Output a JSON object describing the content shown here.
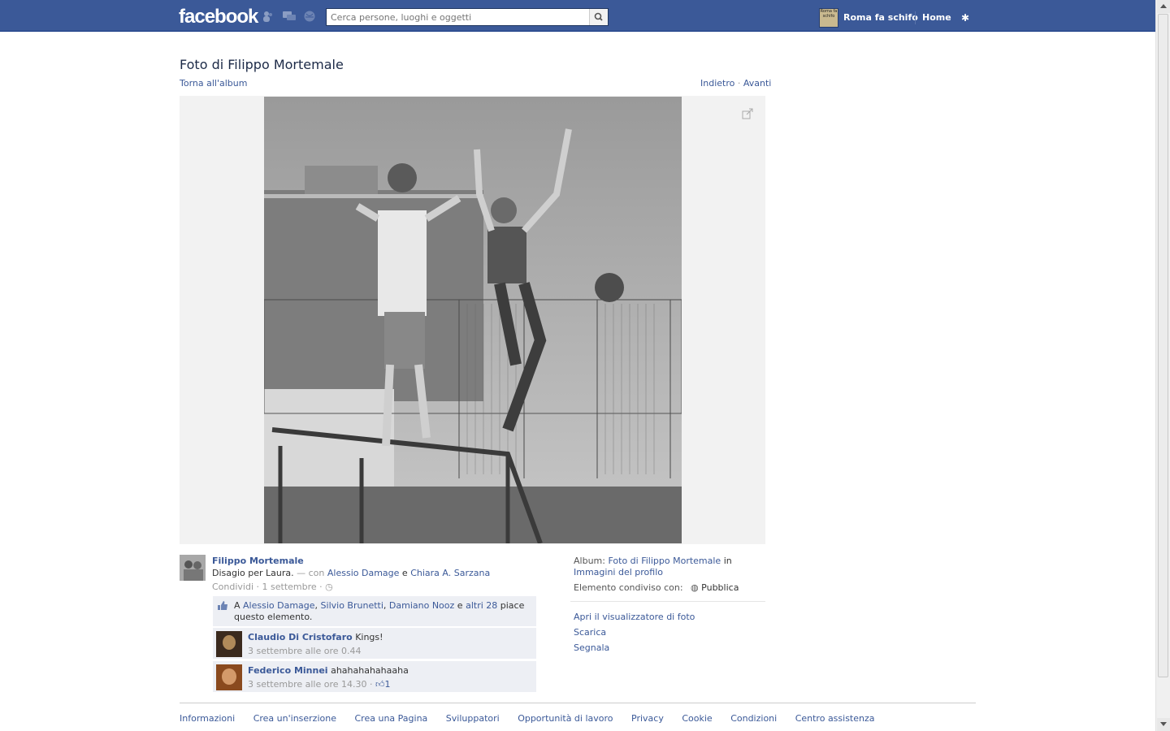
{
  "header": {
    "logo": "facebook",
    "search_placeholder": "Cerca persone, luoghi e oggetti",
    "profile_name": "Roma fa schifo",
    "profile_avatar_text": "Roma fa schifo",
    "home": "Home"
  },
  "page": {
    "title": "Foto di Filippo Mortemale",
    "back_album": "Torna all'album",
    "prev": "Indietro",
    "next": "Avanti",
    "pager_sep": "·"
  },
  "post": {
    "owner": "Filippo Mortemale",
    "caption": "Disagio per Laura.",
    "with_prefix": "— con",
    "tag1": "Alessio Damage",
    "tag_joiner": "e",
    "tag2": "Chiara A. Sarzana",
    "share": "Condividi",
    "date": "1 settembre"
  },
  "likes": {
    "prefix": "A",
    "p1": "Alessio Damage",
    "p2": "Silvio Brunetti",
    "p3": "Damiano Nooz",
    "joiner": "e",
    "others": "altri 28",
    "suffix": "piace questo elemento."
  },
  "comments": [
    {
      "name": "Claudio Di Cristofaro",
      "text": "Kings!",
      "time": "3 settembre alle ore 0.44",
      "likes": ""
    },
    {
      "name": "Federico Minnei",
      "text": "ahahahahahaaha",
      "time": "3 settembre alle ore 14.30",
      "likes": "1"
    }
  ],
  "sidebar": {
    "album_label": "Album:",
    "album_name": "Foto di Filippo Mortemale",
    "album_in": "in",
    "album_parent": "Immagini del profilo",
    "shared_label": "Elemento condiviso con:",
    "shared_value": "Pubblica",
    "actions": [
      "Apri il visualizzatore di foto",
      "Scarica",
      "Segnala"
    ]
  },
  "footer": [
    "Informazioni",
    "Crea un'inserzione",
    "Crea una Pagina",
    "Sviluppatori",
    "Opportunità di lavoro",
    "Privacy",
    "Cookie",
    "Condizioni",
    "Centro assistenza"
  ],
  "colors": {
    "brand": "#3b5998",
    "link": "#3b5998",
    "box": "#edeff4"
  }
}
